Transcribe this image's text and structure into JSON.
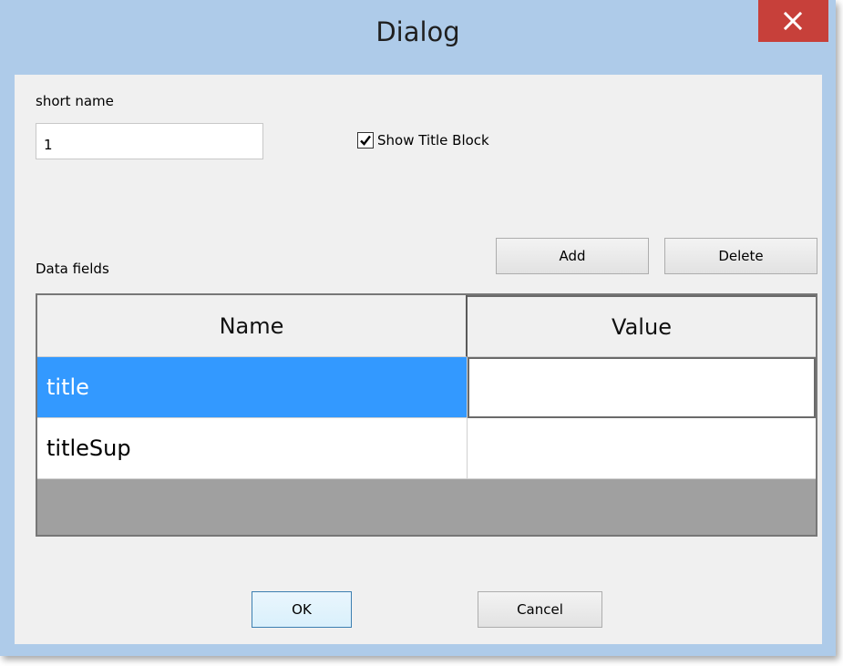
{
  "window": {
    "title": "Dialog",
    "close_icon": "close-icon"
  },
  "form": {
    "short_name_label": "short name",
    "short_name_value": "1",
    "show_title_block_label": "Show Title Block",
    "show_title_block_checked": true,
    "data_fields_label": "Data fields",
    "add_label": "Add",
    "delete_label": "Delete"
  },
  "table": {
    "columns": [
      "Name",
      "Value"
    ],
    "rows": [
      {
        "name": "title",
        "value": "",
        "selected": true
      },
      {
        "name": "titleSup",
        "value": "",
        "selected": false
      }
    ]
  },
  "footer": {
    "ok_label": "OK",
    "cancel_label": "Cancel"
  },
  "colors": {
    "titlebar": "#aecbe9",
    "close": "#c7403a",
    "selection": "#3399ff",
    "table_empty": "#a0a0a0"
  }
}
